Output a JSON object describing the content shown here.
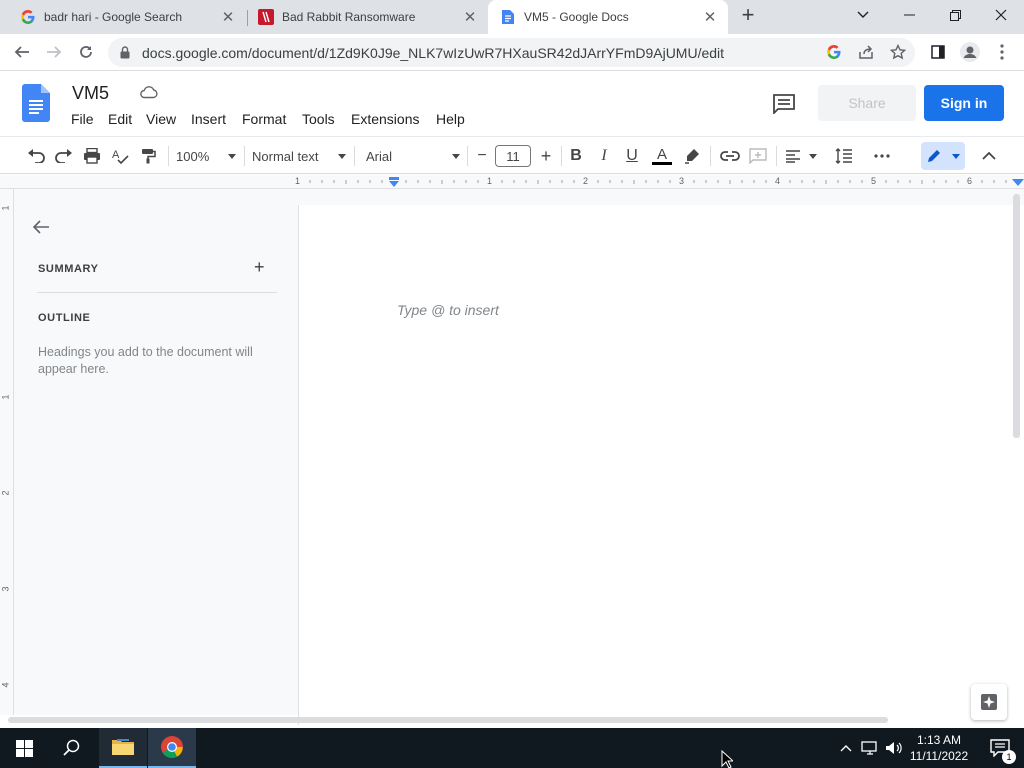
{
  "browser": {
    "tabs": [
      {
        "title": "badr hari - Google Search",
        "icon": "google-g-icon",
        "active": false
      },
      {
        "title": "Bad Rabbit Ransomware",
        "icon": "bad-rabbit-site-icon",
        "active": false
      },
      {
        "title": "VM5 - Google Docs",
        "icon": "google-docs-icon",
        "active": true
      }
    ],
    "new_tab_label": "+",
    "url": "docs.google.com/document/d/1Zd9K0J9e_NLK7wIzUwR7HXauSR42dJArrYFmD9AjUMU/edit"
  },
  "docs": {
    "title": "VM5",
    "menus": [
      "File",
      "Edit",
      "View",
      "Insert",
      "Format",
      "Tools",
      "Extensions",
      "Help"
    ],
    "share_label": "Share",
    "signin_label": "Sign in",
    "toolbar": {
      "zoom": "100%",
      "style": "Normal text",
      "font": "Arial",
      "font_size": "11",
      "minus": "−",
      "plus": "+",
      "bold": "B",
      "italic": "I",
      "underline": "U",
      "text_color_letter": "A",
      "text_color": "#000000"
    },
    "ruler_numbers": [
      "1",
      "1",
      "2",
      "3",
      "4",
      "5",
      "6"
    ],
    "vruler_numbers": [
      "1",
      "1",
      "2",
      "3",
      "4"
    ],
    "outline": {
      "summary_label": "SUMMARY",
      "summary_add": "+",
      "outline_label": "OUTLINE",
      "hint": "Headings you add to the document will appear here."
    },
    "placeholder": "Type @ to insert"
  },
  "taskbar": {
    "time": "1:13 AM",
    "date": "11/11/2022",
    "notification_count": "1"
  },
  "colors": {
    "accent": "#1a73e8",
    "docs_blue": "#4285f4",
    "taskbar": "#101820"
  }
}
